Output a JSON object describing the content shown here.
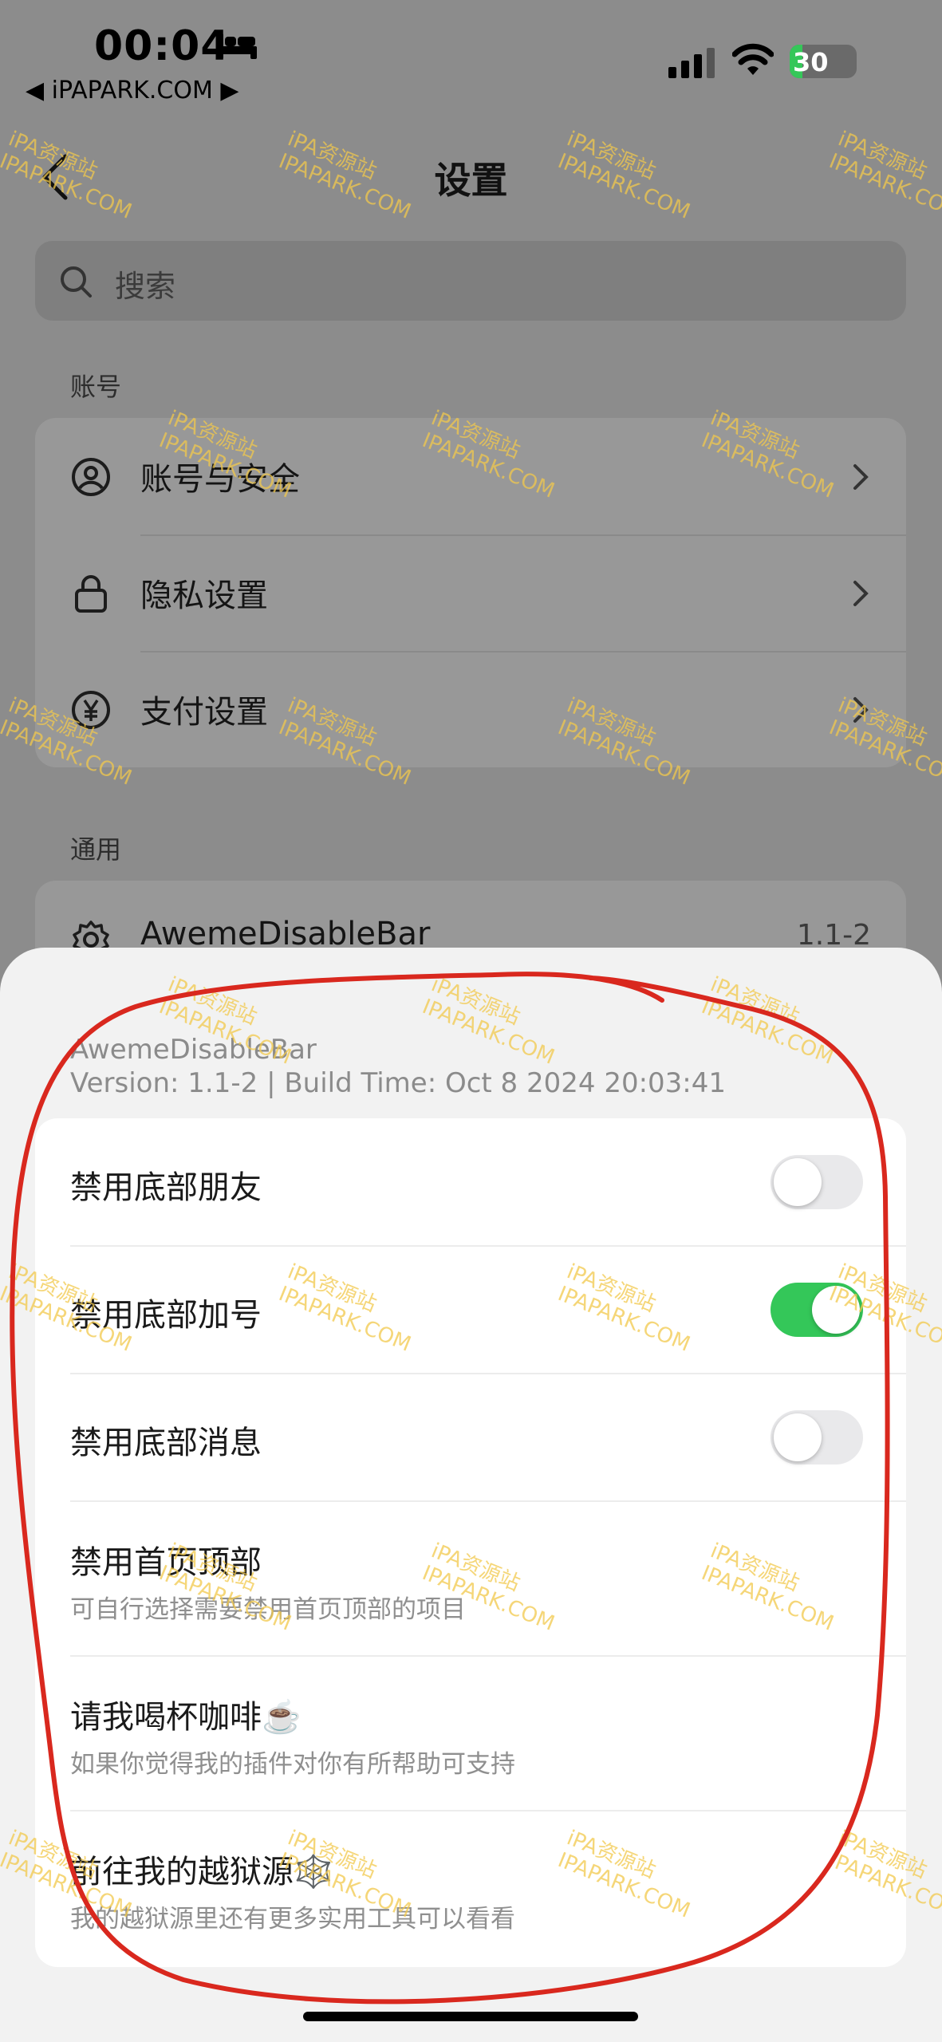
{
  "status": {
    "time": "00:04",
    "back_app": "◀ iPAPARK.COM ▶",
    "battery": "30"
  },
  "nav": {
    "title": "设置"
  },
  "search": {
    "placeholder": "搜索"
  },
  "sections": {
    "account_label": "账号",
    "general_label": "通用"
  },
  "account_items": [
    {
      "label": "账号与安全",
      "icon": "user-circle-icon"
    },
    {
      "label": "隐私设置",
      "icon": "lock-icon"
    },
    {
      "label": "支付设置",
      "icon": "yen-circle-icon"
    }
  ],
  "general_items": [
    {
      "label": "AwemeDisableBar",
      "value": "1.1-2",
      "icon": "gear-icon"
    }
  ],
  "sheet": {
    "name": "AwemeDisableBar",
    "version": "Version: 1.1-2 | Build Time: Oct  8 2024 20:03:41",
    "toggles": [
      {
        "label": "禁用底部朋友",
        "on": false
      },
      {
        "label": "禁用底部加号",
        "on": true
      },
      {
        "label": "禁用底部消息",
        "on": false
      }
    ],
    "links": [
      {
        "title": "禁用首页顶部",
        "subtitle": "可自行选择需要禁用首页顶部的项目"
      },
      {
        "title": "请我喝杯咖啡☕️",
        "subtitle": "如果你觉得我的插件对你有所帮助可支持"
      },
      {
        "title": "前往我的越狱源🕸️",
        "subtitle": "我的越狱源里还有更多实用工具可以看看"
      }
    ]
  },
  "watermark": {
    "line1": "iPA资源站",
    "line2": "IPAPARK.COM"
  },
  "colors": {
    "toggle_on": "#34c759",
    "annotation": "#d9281e"
  }
}
